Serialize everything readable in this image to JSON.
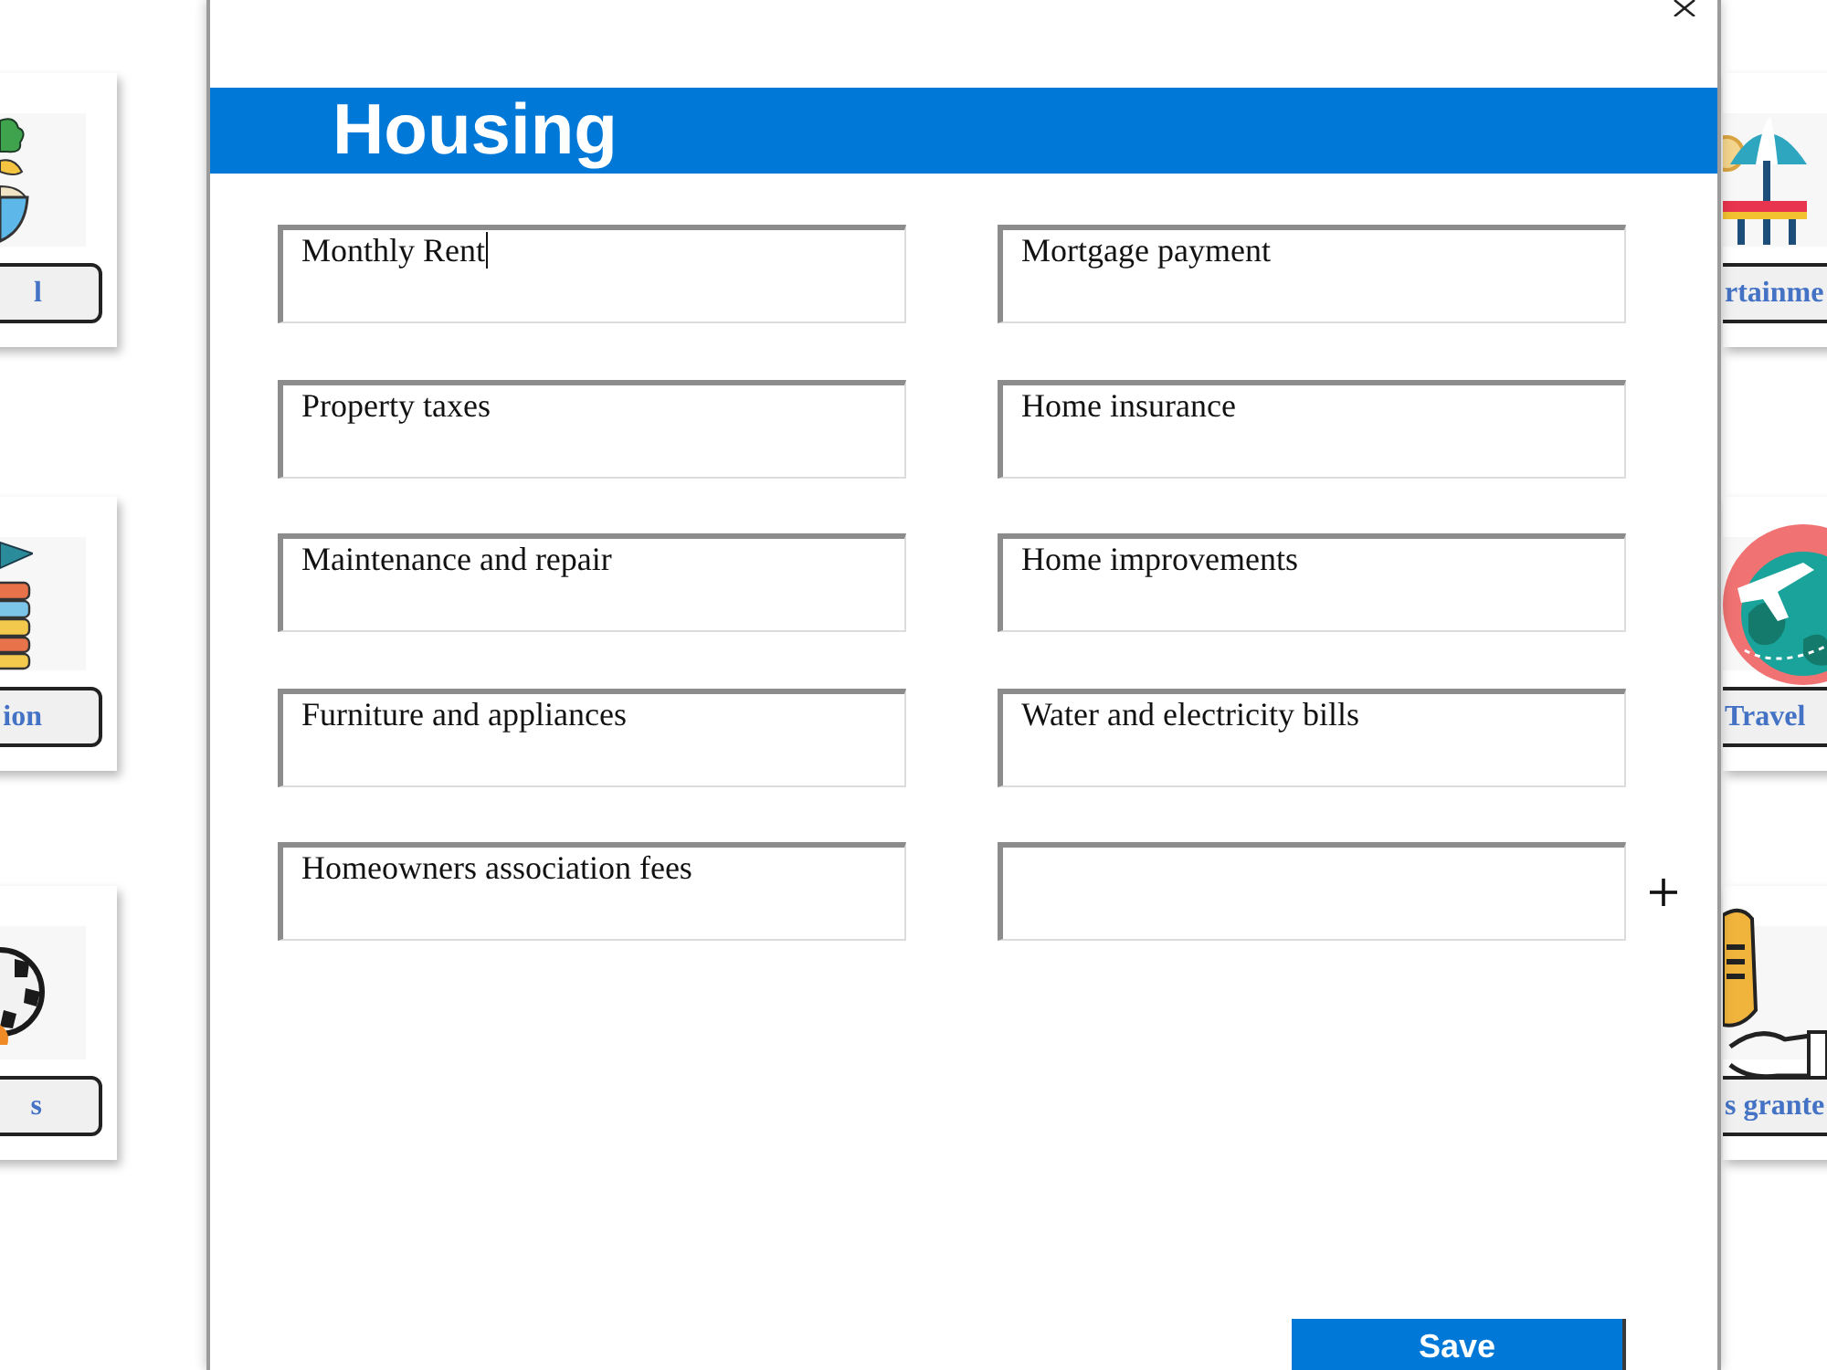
{
  "background_cards": {
    "left": [
      {
        "label": "l"
      },
      {
        "label": "ion"
      },
      {
        "label": "s"
      }
    ],
    "right": [
      {
        "label": "rtainme"
      },
      {
        "label": "Travel"
      },
      {
        "label": "s grante"
      }
    ]
  },
  "dialog": {
    "title": "Housing",
    "fields": [
      {
        "value": "Monthly Rent",
        "focused": true
      },
      {
        "value": "Mortgage payment",
        "focused": false
      },
      {
        "value": "Property taxes",
        "focused": false
      },
      {
        "value": "Home insurance",
        "focused": false
      },
      {
        "value": "Maintenance and repair",
        "focused": false
      },
      {
        "value": "Home improvements",
        "focused": false
      },
      {
        "value": "Furniture and appliances",
        "focused": false
      },
      {
        "value": "Water and electricity bills",
        "focused": false
      },
      {
        "value": "Homeowners association fees",
        "focused": false
      },
      {
        "focused": false
      }
    ],
    "save_button": "Save"
  }
}
